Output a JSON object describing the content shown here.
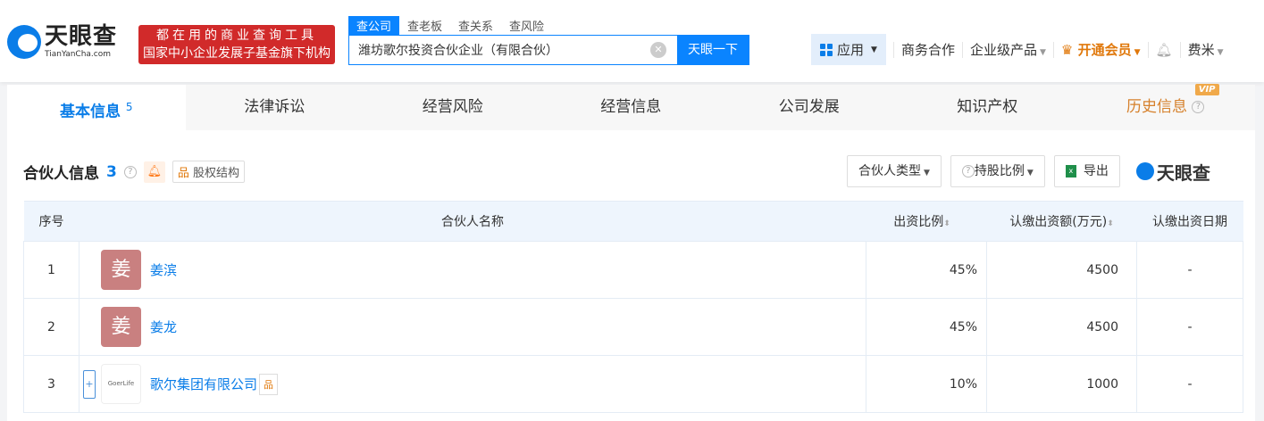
{
  "header": {
    "logo_cn": "天眼查",
    "logo_en": "TianYanCha.com",
    "slogan1": "都在用的商业查询工具",
    "slogan2": "国家中小企业发展子基金旗下机构",
    "search_tabs": [
      "查公司",
      "查老板",
      "查关系",
      "查风险"
    ],
    "search_value": "潍坊歌尔投资合伙企业（有限合伙）",
    "search_button": "天眼一下",
    "nav": {
      "apps": "应用",
      "business": "商务合作",
      "enterprise": "企业级产品",
      "vip": "开通会员",
      "user": "费米"
    }
  },
  "tabs": [
    {
      "label": "基本信息",
      "count": "5"
    },
    {
      "label": "法律诉讼"
    },
    {
      "label": "经营风险"
    },
    {
      "label": "经营信息"
    },
    {
      "label": "公司发展"
    },
    {
      "label": "知识产权"
    },
    {
      "label": "历史信息",
      "badge": "VIP"
    }
  ],
  "section": {
    "title": "合伙人信息",
    "count": "3",
    "equity": "股权结构",
    "filter_type": "合伙人类型",
    "filter_ratio": "持股比例",
    "export": "导出",
    "brand": "天眼查"
  },
  "table": {
    "headers": [
      "序号",
      "合伙人名称",
      "出资比例",
      "认缴出资额(万元)",
      "认缴出资日期"
    ],
    "rows": [
      {
        "no": "1",
        "avatar": "姜",
        "name": "姜滨",
        "ratio": "45%",
        "amount": "4500",
        "date": "-"
      },
      {
        "no": "2",
        "avatar": "姜",
        "name": "姜龙",
        "ratio": "45%",
        "amount": "4500",
        "date": "-"
      },
      {
        "no": "3",
        "avatar": "GoerLife",
        "name": "歌尔集团有限公司",
        "ratio": "10%",
        "amount": "1000",
        "date": "-"
      }
    ]
  },
  "colors": {
    "accent": "#0a84ff",
    "vip": "#e0780b",
    "slogan_bg": "#d12a2a",
    "avatar_bg": "#c98080"
  }
}
